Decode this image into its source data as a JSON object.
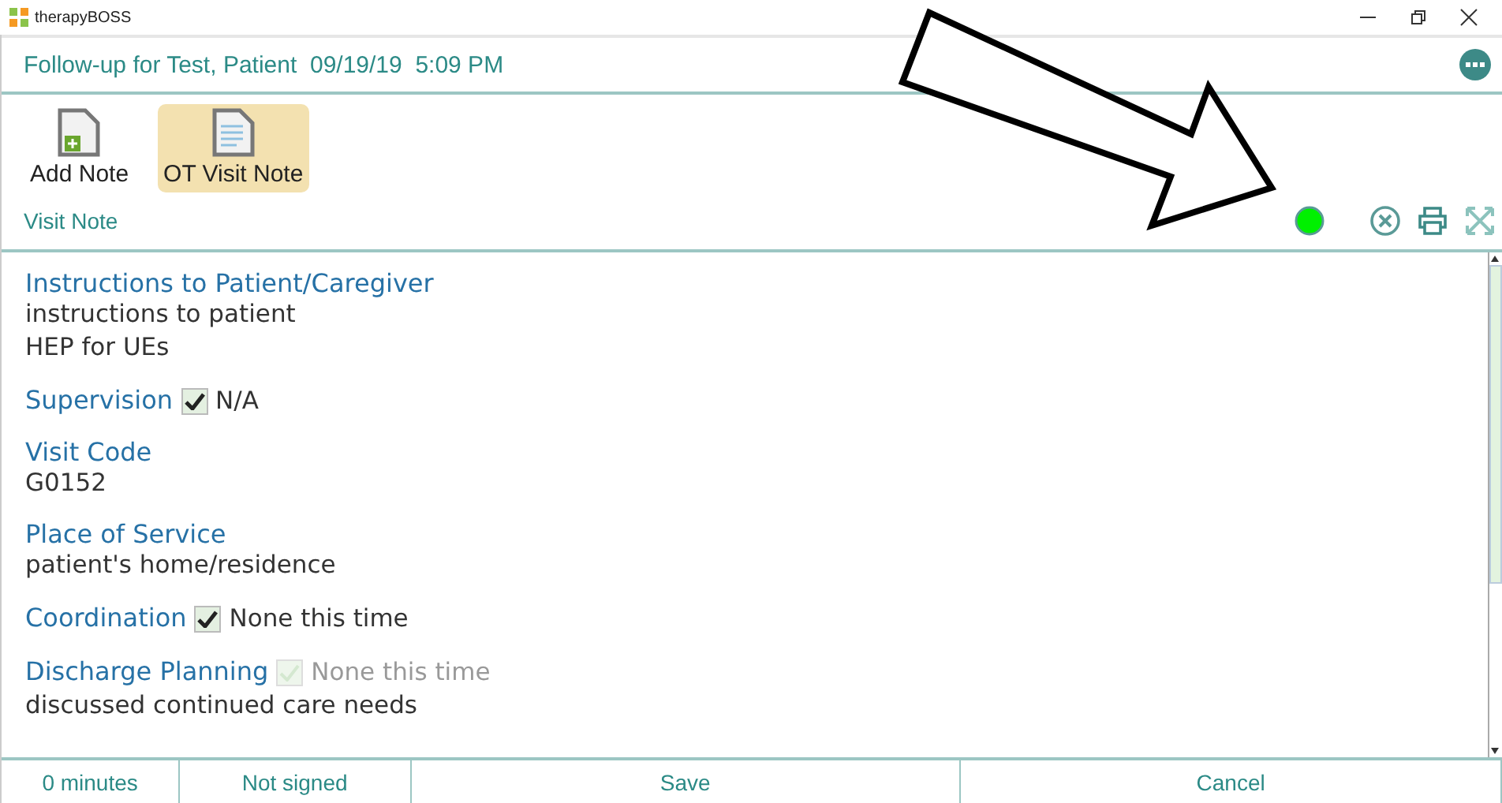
{
  "window": {
    "app_name": "therapyBOSS"
  },
  "header": {
    "title": "Follow-up for Test, Patient  09/19/19  5:09 PM"
  },
  "toolbar": [
    {
      "label": "Add Note",
      "kind": "add",
      "selected": false
    },
    {
      "label": "OT Visit Note",
      "kind": "note",
      "selected": true
    }
  ],
  "section_title": "Visit Note",
  "sections": [
    {
      "label": "Instructions to Patient/Caregiver",
      "lines": [
        "instructions to patient",
        "HEP for UEs"
      ]
    },
    {
      "label": "Supervision",
      "checkbox": {
        "checked": true,
        "disabled": false,
        "label": "N/A"
      }
    },
    {
      "label": "Visit Code",
      "lines": [
        "G0152"
      ]
    },
    {
      "label": "Place of Service",
      "lines": [
        "patient's home/residence"
      ]
    },
    {
      "label": "Coordination",
      "checkbox": {
        "checked": true,
        "disabled": false,
        "label": "None this time"
      }
    },
    {
      "label": "Discharge Planning",
      "checkbox": {
        "checked": true,
        "disabled": true,
        "label": "None this time"
      },
      "lines": [
        "discussed continued care needs"
      ]
    }
  ],
  "footer": [
    "0 minutes",
    "Not signed",
    "Save",
    "Cancel"
  ]
}
